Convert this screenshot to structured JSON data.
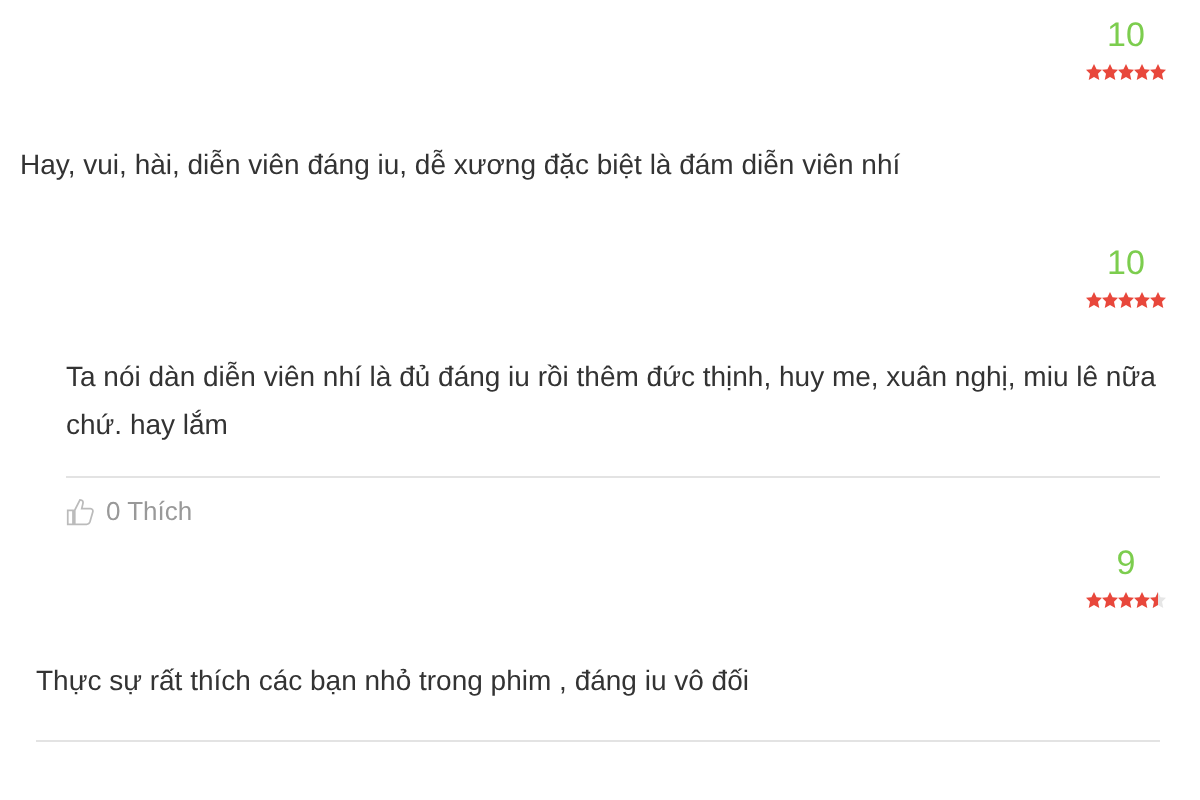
{
  "reviews": [
    {
      "kind": "plain",
      "score": "10",
      "stars": 5,
      "text": "Hay, vui, hài, diễn viên đáng iu, dễ xương đặc biệt là đám diễn viên nhí"
    },
    {
      "kind": "boxed",
      "score": "10",
      "stars": 5,
      "text": "Ta nói dàn diễn viên nhí là đủ đáng iu rồi thêm đức thịnh, huy me, xuân nghị, miu lê nữa chứ. hay lắm",
      "likes": "0 Thích"
    },
    {
      "kind": "inset",
      "score": "9",
      "stars": 4.5,
      "text": "Thực sự rất thích các bạn nhỏ trong phim , đáng iu vô đối"
    }
  ]
}
